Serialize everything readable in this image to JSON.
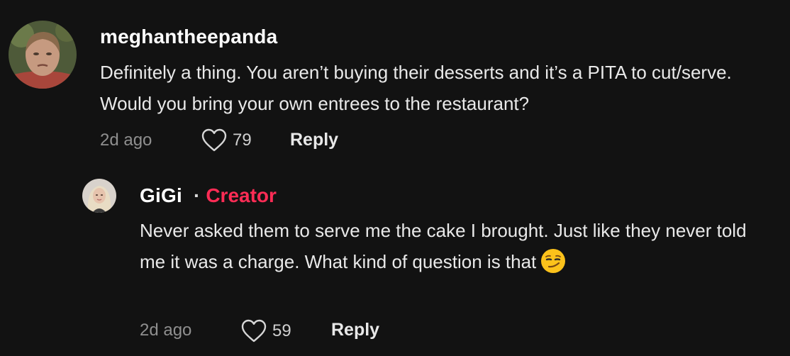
{
  "comments": [
    {
      "username": "meghantheepanda",
      "text": "Definitely a thing. You aren’t buying their desserts and it’s a PITA to cut/serve. Would you bring your own entrees to the restaurant?",
      "time": "2d ago",
      "likes": "79",
      "reply_label": "Reply"
    }
  ],
  "reply": {
    "username": "GiGi",
    "separator": "·",
    "badge": "Creator",
    "text": "Never asked them to serve me the cake I brought. Just like they never told me it was a charge. What kind of question is that",
    "emoji": "smirking-face",
    "time": "2d ago",
    "likes": "59",
    "reply_label": "Reply"
  },
  "colors": {
    "background": "#121212",
    "creator_badge": "#fe2c55",
    "muted_text": "#8f8f8f"
  }
}
